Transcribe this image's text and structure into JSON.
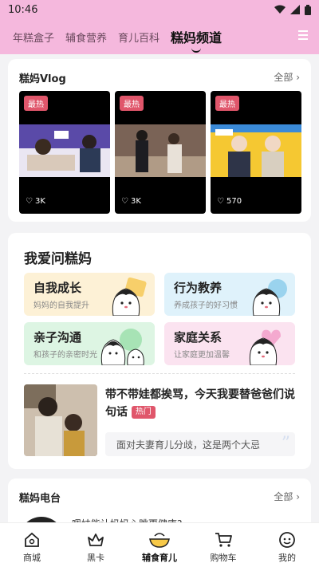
{
  "status_bar": {
    "time": "10:46"
  },
  "top_nav": {
    "tabs": [
      {
        "label": "年糕盒子"
      },
      {
        "label": "辅食营养"
      },
      {
        "label": "育儿百科"
      },
      {
        "label": "糕妈频道",
        "active": true
      }
    ]
  },
  "vlog": {
    "title": "糕妈Vlog",
    "more": "全部",
    "videos": [
      {
        "badge": "最热",
        "likes": "3K"
      },
      {
        "badge": "最热",
        "likes": "3K"
      },
      {
        "badge": "最热",
        "likes": "570"
      }
    ]
  },
  "ask": {
    "title": "我爱问糕妈",
    "categories": [
      {
        "title": "自我成长",
        "subtitle": "妈妈的自我提升",
        "color": "#fdf1d6"
      },
      {
        "title": "行为教养",
        "subtitle": "养成孩子的好习惯",
        "color": "#dff2fb"
      },
      {
        "title": "亲子沟通",
        "subtitle": "和孩子的亲密时光",
        "color": "#ddf5e3"
      },
      {
        "title": "家庭关系",
        "subtitle": "让家庭更加温馨",
        "color": "#fbe3f0"
      }
    ],
    "post": {
      "title": "带不带娃都挨骂，今天我要替爸爸们说句话",
      "tag": "热门",
      "quote": "面对夫妻育儿分歧，这是两个大忌"
    }
  },
  "radio": {
    "title": "糕妈电台",
    "more": "全部",
    "item": "嗯妹能让妈妈心跳更健康?"
  },
  "tab_bar": {
    "items": [
      {
        "label": "商城"
      },
      {
        "label": "黑卡"
      },
      {
        "label": "辅食育儿",
        "active": true
      },
      {
        "label": "购物车"
      },
      {
        "label": "我的"
      }
    ]
  },
  "colors": {
    "header_pink": "#f5b8dd",
    "badge_red": "#e0566b"
  }
}
